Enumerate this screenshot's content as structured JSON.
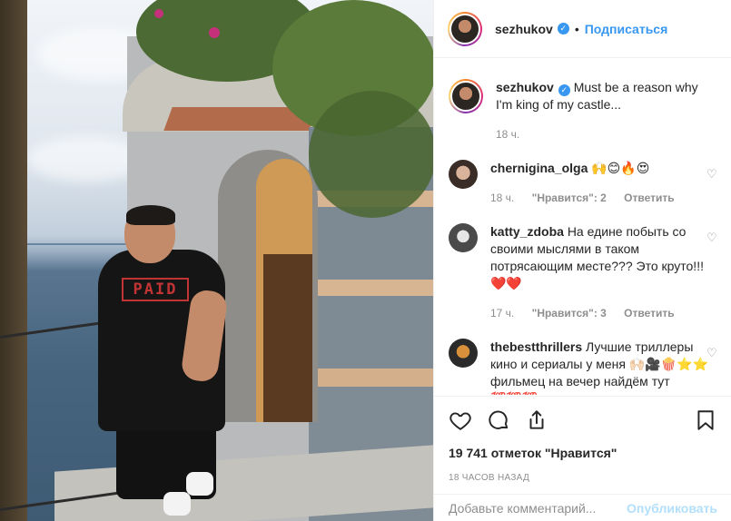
{
  "post": {
    "author": "sezhukov",
    "follow_label": "Подписаться",
    "dot": "•"
  },
  "caption": {
    "username": "sezhukov",
    "text": "Must be a reason why I'm king of my castle...",
    "time": "18 ч."
  },
  "comments": [
    {
      "username": "chernigina_olga",
      "text": "🙌😊🔥😍",
      "time": "18 ч.",
      "likes": "\"Нравится\": 2",
      "reply": "Ответить"
    },
    {
      "username": "katty_zdoba",
      "text": "На едине побыть со своими мыслями в таком потрясающим месте??? Это круто!!! ❤️❤️",
      "time": "17 ч.",
      "likes": "\"Нравится\": 3",
      "reply": "Ответить"
    },
    {
      "username": "thebestthrillers",
      "text": "Лучшие триллеры кино и сериалы у меня 🙌🏻🎥🍿⭐⭐ фильмец на вечер найдём тут 💯💯💯"
    }
  ],
  "actions": {
    "like_count": "19 741 отметок \"Нравится\"",
    "timestamp": "18 ЧАСОВ НАЗАД"
  },
  "composer": {
    "placeholder": "Добавьте комментарий...",
    "publish_label": "Опубликовать"
  },
  "colors": {
    "accent": "#3897f0",
    "publish_disabled": "#b2dffc",
    "muted": "#8e8e8e"
  }
}
